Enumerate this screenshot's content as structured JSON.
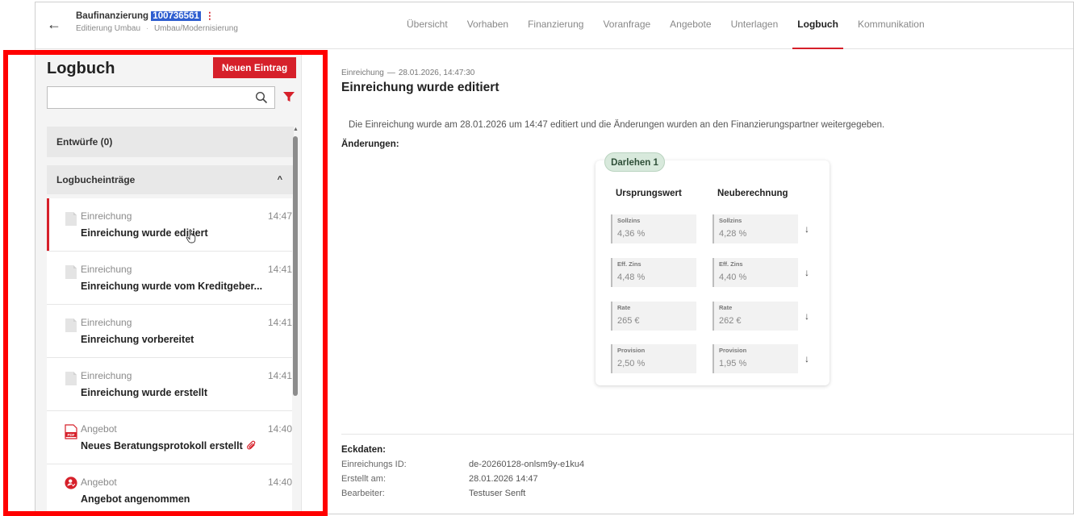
{
  "header": {
    "back_label": "←",
    "title": "Baufinanzierung",
    "case_id": "100736561",
    "menu_glyph": "⋮",
    "sub_left": "Editierung Umbau",
    "sub_sep": "·",
    "sub_right": "Umbau/Modernisierung"
  },
  "tabs": [
    {
      "label": "Übersicht",
      "active": false
    },
    {
      "label": "Vorhaben",
      "active": false
    },
    {
      "label": "Finanzierung",
      "active": false
    },
    {
      "label": "Voranfrage",
      "active": false
    },
    {
      "label": "Angebote",
      "active": false
    },
    {
      "label": "Unterlagen",
      "active": false
    },
    {
      "label": "Logbuch",
      "active": true
    },
    {
      "label": "Kommunikation",
      "active": false
    }
  ],
  "left": {
    "title": "Logbuch",
    "new_entry_label": "Neuen Eintrag",
    "search_value": "",
    "search_placeholder": "",
    "drafts_label": "Entwürfe (0)",
    "section_label": "Logbucheinträge",
    "section_chevron": "^",
    "entries": [
      {
        "category": "Einreichung",
        "time": "14:47",
        "title": "Einreichung wurde editiert",
        "icon": "document-icon",
        "active": true
      },
      {
        "category": "Einreichung",
        "time": "14:41",
        "title": "Einreichung wurde vom Kreditgeber...",
        "icon": "document-icon",
        "active": false
      },
      {
        "category": "Einreichung",
        "time": "14:41",
        "title": "Einreichung vorbereitet",
        "icon": "document-icon",
        "active": false
      },
      {
        "category": "Einreichung",
        "time": "14:41",
        "title": "Einreichung wurde erstellt",
        "icon": "document-icon",
        "active": false
      },
      {
        "category": "Angebot",
        "time": "14:40",
        "title": "Neues Beratungsprotokoll erstellt",
        "icon": "pdf-icon",
        "active": false
      },
      {
        "category": "Angebot",
        "time": "14:40",
        "title": "Angebot angenommen",
        "icon": "user-check-icon",
        "active": false
      }
    ]
  },
  "detail": {
    "meta_category": "Einreichung",
    "meta_dash": "—",
    "meta_datetime": "28.01.2026, 14:47:30",
    "title": "Einreichung wurde editiert",
    "description": "Die Einreichung wurde am 28.01.2026 um 14:47  editiert und die Änderungen wurden an den Finanzierungspartner weitergegeben.",
    "changes_label": "Änderungen:",
    "card": {
      "badge": "Darlehen 1",
      "col_original": "Ursprungswert",
      "col_new": "Neuberechnung",
      "arrow": "↓",
      "rows": [
        {
          "label": "Sollzins",
          "original": "4,36 %",
          "new": "4,28 %"
        },
        {
          "label": "Eff. Zins",
          "original": "4,48 %",
          "new": "4,40 %"
        },
        {
          "label": "Rate",
          "original": "265 €",
          "new": "262 €"
        },
        {
          "label": "Provision",
          "original": "2,50 %",
          "new": "1,95 %"
        }
      ]
    },
    "eckdaten": {
      "title": "Eckdaten:",
      "rows": [
        {
          "key": "Einreichungs ID:",
          "value": "de-20260128-onlsm9y-e1ku4"
        },
        {
          "key": "Erstellt am:",
          "value": "28.01.2026 14:47"
        },
        {
          "key": "Bearbeiter:",
          "value": "Testuser Senft"
        }
      ]
    }
  },
  "colors": {
    "accent_red": "#d6202a",
    "badge_green": "#d8e9dc",
    "id_highlight": "#2f5fd0",
    "annotation_frame": "#ff0000"
  }
}
